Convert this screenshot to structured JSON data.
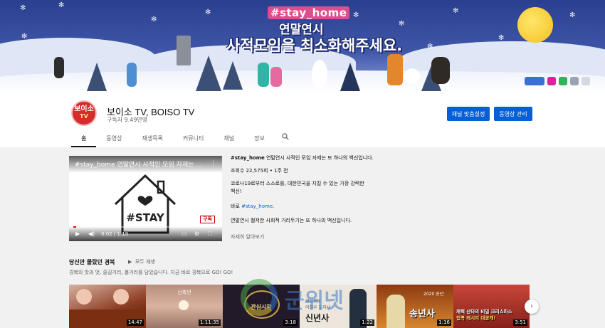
{
  "banner": {
    "hashtag": "#stay_home",
    "line1": "연말연시",
    "line2": "사적모임을 최소화해주세요."
  },
  "channel": {
    "avatar_text_top": "보이소",
    "avatar_text_bottom": "TV",
    "name": "보이소 TV, BOISO TV",
    "subscribers": "구독자 9.49만명",
    "customize_button": "채널 맞춤설정",
    "manage_button": "동영상 관리"
  },
  "tabs": [
    "홈",
    "동영상",
    "재생목록",
    "커뮤니티",
    "채널",
    "정보"
  ],
  "featured": {
    "title": "#stay_home 연말연시 사적인 모임 자제는 ...",
    "house_text": "#STAY",
    "subscribe_badge": "구독",
    "time": "0:02 / 1:19",
    "info_title_bold": "#stay_home",
    "info_title_rest": " 연말연시 사적인 모임 자제는 또 하나의 백신입니다.",
    "meta": "조회수 22,575회 • 1주 전",
    "desc_line1": "코로나19로부터 스스로를, 대한민국을 지킬 수 있는 가장 강력한",
    "desc_line2": "백신!",
    "desc_line3_prefix": "바로 ",
    "desc_line3_link": "#stay_home.",
    "desc_line4": "연말연시 철저한 사회적 거리두기는 또 하나의 백신입니다.",
    "more": "자세히 알아보기"
  },
  "shelf": {
    "title": "당신만 몰랐던 경북",
    "play_all": "모두 재생",
    "description": "경북의 맛과 멋, 즐길거리, 볼거리를 담았습니다. 지금 바로 경북으로 GO! GO!",
    "thumbnails": [
      {
        "duration": "14:47",
        "color": "#a0522d"
      },
      {
        "duration": "1:11:35",
        "color": "#c9a08a",
        "caption": "신축년"
      },
      {
        "duration": "3:18",
        "color": "#2a2230",
        "caption": "관심시작"
      },
      {
        "duration": "1:22",
        "color": "#ece6dd",
        "caption_top": "경상북도",
        "caption_mid": "이철우 도지사",
        "caption": "신년사"
      },
      {
        "duration": "1:16",
        "color": "#c8782c",
        "caption": "송년사",
        "badge": "2020 송년"
      },
      {
        "duration": "3:51",
        "color": "#b33a2e",
        "caption": "재택 산타의 비밀 크리스마스",
        "caption2": "집콕 레시피 대공개!"
      }
    ]
  },
  "watermark": {
    "text": "군위넷"
  },
  "colors": {
    "accent": "#065fd4",
    "brand": "#d52c2c",
    "progress": "#ff0000"
  }
}
